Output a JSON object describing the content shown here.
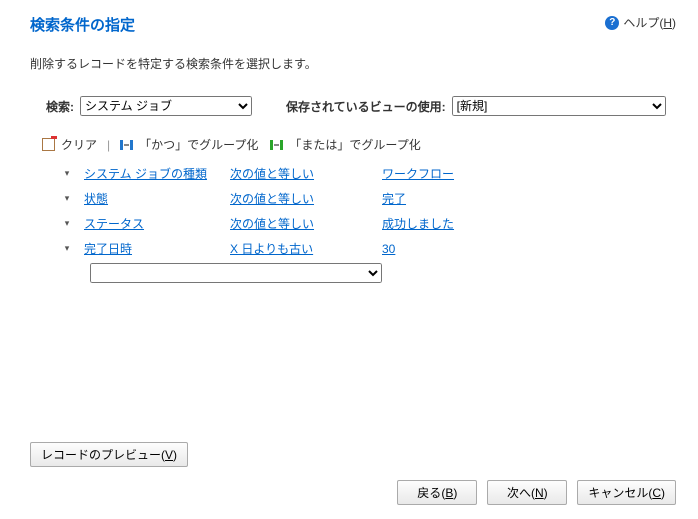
{
  "header": {
    "title": "検索条件の指定",
    "help_label": "ヘルプ",
    "help_key": "H"
  },
  "description": "削除するレコードを特定する検索条件を選択します。",
  "search": {
    "label": "検索:",
    "value": "システム ジョブ",
    "view_label": "保存されているビューの使用:",
    "view_value": "[新規]"
  },
  "toolbar": {
    "clear": "クリア",
    "group_and": "「かつ」でグループ化",
    "group_or": "「または」でグループ化"
  },
  "criteria": [
    {
      "field": "システム ジョブの種類",
      "operator": "次の値と等しい",
      "value": "ワークフロー"
    },
    {
      "field": "状態",
      "operator": "次の値と等しい",
      "value": "完了"
    },
    {
      "field": "ステータス",
      "operator": "次の値と等しい",
      "value": "成功しました"
    },
    {
      "field": "完了日時",
      "operator": "X 日よりも古い",
      "value": "30"
    }
  ],
  "buttons": {
    "preview": "レコードのプレビュー",
    "preview_key": "V",
    "back": "戻る",
    "back_key": "B",
    "next": "次へ",
    "next_key": "N",
    "cancel": "キャンセル",
    "cancel_key": "C"
  }
}
